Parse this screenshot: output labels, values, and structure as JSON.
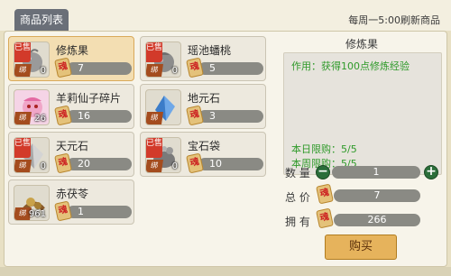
{
  "header": {
    "tab_label": "商品列表",
    "refresh_text": "每周一5:00刷新商品"
  },
  "badges": {
    "sold": "已售",
    "bind": "绑",
    "currency": "魂"
  },
  "items": [
    {
      "name": "修炼果",
      "price": "7",
      "qty": "0",
      "sold": true,
      "selected": true,
      "icon": "gray-fruit-icon"
    },
    {
      "name": "瑶池蟠桃",
      "price": "5",
      "qty": "0",
      "sold": true,
      "selected": false,
      "icon": "gray-peach-icon"
    },
    {
      "name": "羊莉仙子碎片",
      "price": "16",
      "qty": "26",
      "sold": false,
      "selected": false,
      "icon": "fairy-fragment-icon"
    },
    {
      "name": "地元石",
      "price": "3",
      "qty": "",
      "sold": false,
      "selected": false,
      "icon": "blue-crystal-icon"
    },
    {
      "name": "天元石",
      "price": "20",
      "qty": "0",
      "sold": true,
      "selected": false,
      "icon": "white-crystal-icon"
    },
    {
      "name": "宝石袋",
      "price": "10",
      "qty": "0",
      "sold": true,
      "selected": false,
      "icon": "gem-bag-icon"
    },
    {
      "name": "赤茯苓",
      "price": "1",
      "qty": "961",
      "sold": false,
      "selected": false,
      "icon": "red-herb-icon"
    }
  ],
  "detail": {
    "title": "修炼果",
    "desc": "作用：获得100点修炼经验",
    "daily_limit": "本日限购：5/5",
    "weekly_limit": "本周限购：5/5",
    "qty_label": "数 量",
    "qty_value": "1",
    "total_label": "总 价",
    "total_value": "7",
    "own_label": "拥 有",
    "own_value": "266",
    "minus": "−",
    "plus": "+",
    "buy_label": "购买"
  }
}
